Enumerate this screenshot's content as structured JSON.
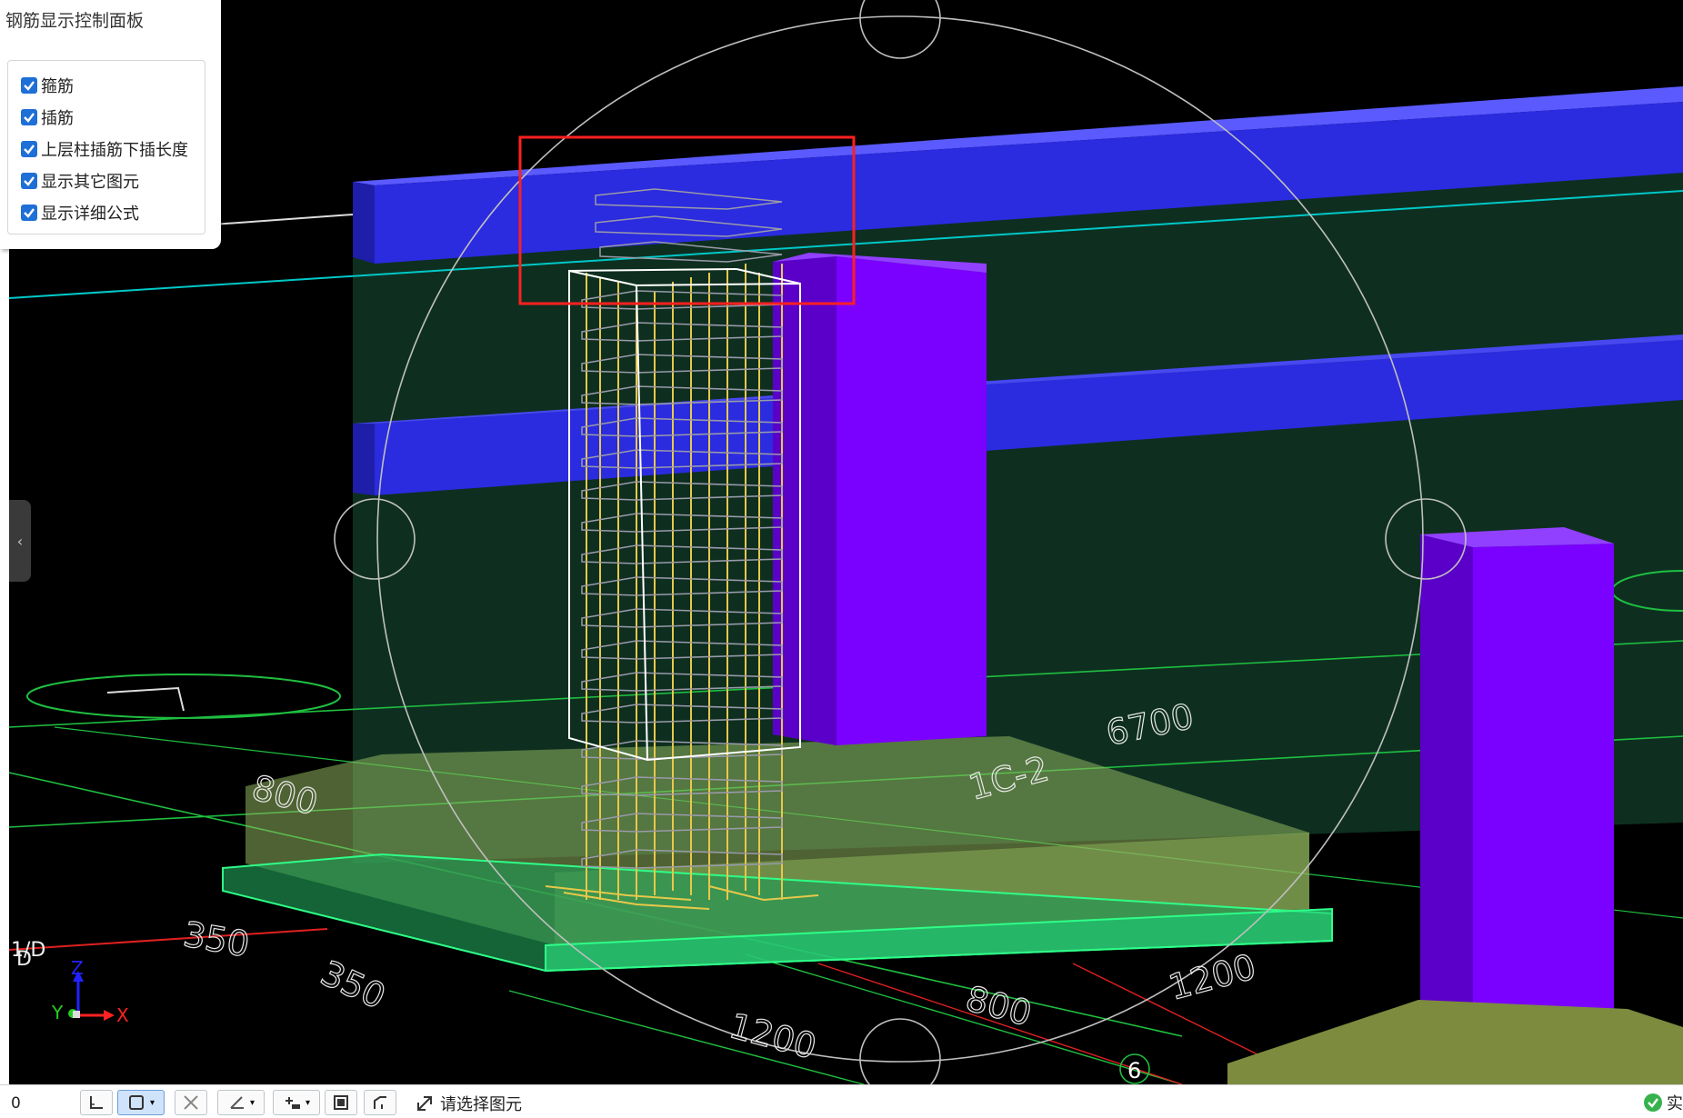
{
  "panel": {
    "title": "钢筋显示控制面板",
    "options": [
      {
        "label": "箍筋",
        "checked": true
      },
      {
        "label": "插筋",
        "checked": true
      },
      {
        "label": "上层柱插筋下插长度",
        "checked": true
      },
      {
        "label": "显示其它图元",
        "checked": true
      },
      {
        "label": "显示详细公式",
        "checked": true
      }
    ]
  },
  "viewport": {
    "dimension_labels": [
      "6700",
      "800",
      "1200",
      "800",
      "1200",
      "350",
      "1C-2",
      "350"
    ],
    "axis_markers": [
      "1/D",
      "D",
      "6"
    ],
    "axis_gizmo": {
      "z": "Z",
      "y": "Y",
      "x": "X"
    }
  },
  "statusbar": {
    "coordinate": "0",
    "hint": "请选择图元",
    "status_text": "实",
    "tools": [
      "orthogonal-icon",
      "select-box-icon",
      "cross-snap-icon",
      "angle-icon",
      "offset-icon",
      "grid-snap-icon",
      "curve-icon"
    ]
  },
  "colors": {
    "beam_blue": "#2e2ee8",
    "column_purple": "#7a00ff",
    "slab_green": "#0e2e1e",
    "footing_green": "#2ecc71",
    "rebar_yellow": "#e8c84a",
    "highlight_red": "#ff2020",
    "checkbox_blue": "#1e6fd6"
  }
}
